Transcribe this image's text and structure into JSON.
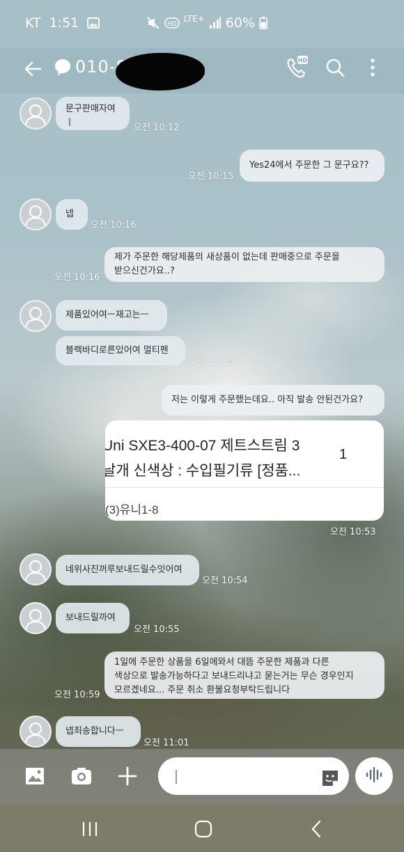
{
  "status_bar": {
    "carrier": "KT",
    "time": "1:51",
    "network": "LTE+",
    "battery": "60%"
  },
  "header": {
    "contact": "010-8"
  },
  "messages": [
    {
      "side": "in",
      "text": "문구판매자여\nㅣ",
      "time": "오전 10:12"
    },
    {
      "side": "out",
      "text": "Yes24에서 주문한 그 문구요??",
      "time": "오전 10:15"
    },
    {
      "side": "in",
      "text": "넵",
      "time": "오전 10:16"
    },
    {
      "side": "out",
      "text": "제가 주문한 해당제품의 새상품이 없는데 판매중으로 주문을\n받으신건가요..?",
      "time": "오전 10:16"
    },
    {
      "side": "in",
      "text": "제품있어여ㅡ재고는ㅡ",
      "time": ""
    },
    {
      "side": "in",
      "text": "블렉바디로른있어여 멀티펜",
      "time": "오전 10:50"
    },
    {
      "side": "out",
      "text": "저는 이렇게 주문했는데요.. 아직 발송 안된건가요?",
      "time": ""
    },
    {
      "side": "in",
      "text": "네위사진꺼루보내드릴수잇어여",
      "time": "오전 10:54"
    },
    {
      "side": "in",
      "text": "보내드릴까여",
      "time": "오전 10:55"
    },
    {
      "side": "out",
      "text": "1일에 주문한 상품을 6일에와서 대뜸 주문한 제품과 다른\n색상으로 발송가능하다고 보내드리냐고 묻는거는 무슨 경우인지\n모르겠네요... 주문 취소 환불요청부탁드립니다",
      "time": "오전 10:59"
    },
    {
      "side": "in",
      "text": "넵죄송합니다ㅡ",
      "time": "오전 11:01"
    }
  ],
  "product_card": {
    "title_line1": "Uni SXE3-400-07 제트스트림 3",
    "title_line2": "날개 신색상 : 수입필기류 [정품...",
    "quantity": "1",
    "subtitle": "(3)유니1-8",
    "time": "오전 10:53"
  },
  "input": {
    "value": ""
  },
  "colors": {
    "bubble": "#ecf0f2",
    "text": "#2b2b2b",
    "timestamp": "#f2f6f7"
  }
}
